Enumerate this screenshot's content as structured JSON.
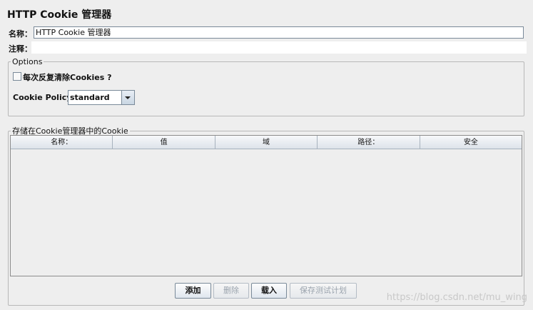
{
  "panel": {
    "title": "HTTP Cookie 管理器"
  },
  "fields": {
    "name_label": "名称：",
    "name_value": "HTTP Cookie 管理器",
    "comment_label": "注释：",
    "comment_value": ""
  },
  "options": {
    "legend": "Options",
    "clear_each_iteration_label": "每次反复清除Cookies ?",
    "clear_each_iteration_checked": false,
    "policy_label": "Cookie Policy:",
    "policy_value": "standard"
  },
  "cookies": {
    "legend": "存储在Cookie管理器中的Cookie",
    "columns": [
      "名称：",
      "值",
      "域",
      "路径：",
      "安全"
    ],
    "rows": []
  },
  "buttons": {
    "add": "添加",
    "delete": "删除",
    "load": "载入",
    "save_test_plan": "保存测试计划"
  },
  "watermark": "https://blog.csdn.net/mu_wing"
}
